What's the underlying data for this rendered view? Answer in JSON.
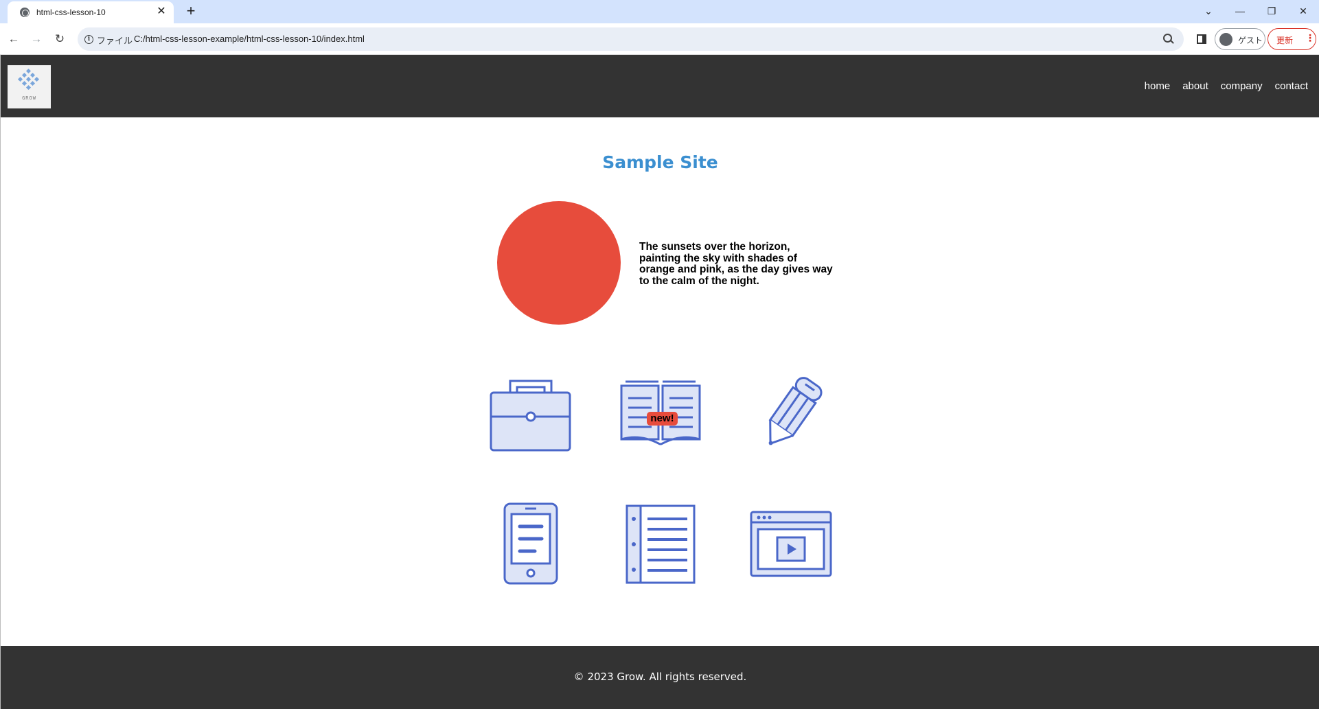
{
  "browser": {
    "tab_title": "html-css-lesson-10",
    "tab_close": "✕",
    "new_tab": "+",
    "window_controls": {
      "dropdown": "⌄",
      "minimize": "—",
      "restore": "❐",
      "close": "✕"
    },
    "back": "←",
    "forward": "→",
    "reload": "↻",
    "file_label": "ファイル",
    "url": "C:/html-css-lesson-example/html-css-lesson-10/index.html",
    "guest_label": "ゲスト",
    "update_label": "更新",
    "update_menu": "⋮"
  },
  "site": {
    "logo_text": "GROW",
    "nav": [
      "home",
      "about",
      "company",
      "contact"
    ],
    "title": "Sample Site",
    "description": "The sunsets over the horizon, painting the sky with shades of orange and pink, as the day gives way to the calm of the night.",
    "badge": "new!",
    "icons": [
      "briefcase-icon",
      "book-icon",
      "pencil-icon",
      "smartphone-icon",
      "notebook-icon",
      "video-player-icon"
    ],
    "footer": "© 2023 Grow. All rights reserved."
  },
  "colors": {
    "header_bg": "#333333",
    "title_blue": "#3b8fd0",
    "sun_red": "#e74c3c",
    "icon_stroke": "#4a67c9",
    "icon_fill": "#dde4f7"
  }
}
